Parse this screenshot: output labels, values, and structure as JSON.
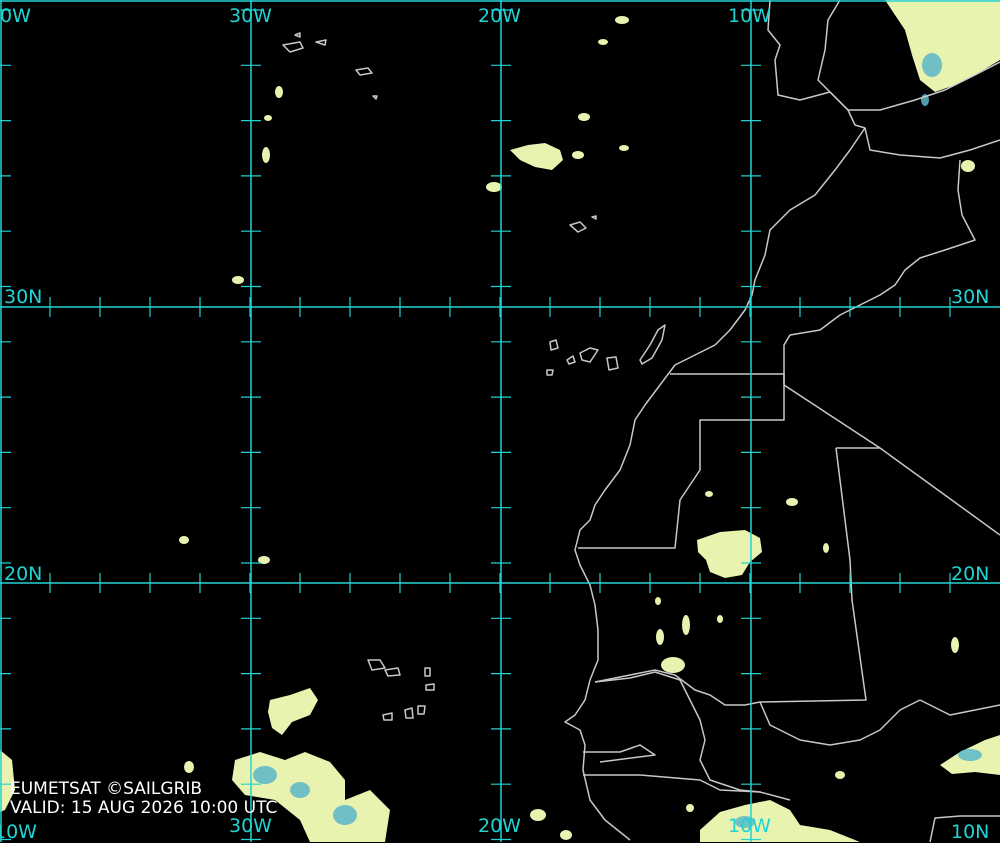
{
  "map": {
    "product": "satellite-cloud-image",
    "grid_color": "#22d3d3",
    "coast_color": "#c8c8c8",
    "cloud_color": "#e8f3b0",
    "deep_cloud_color": "#5bb7c9",
    "longitude_labels_top": [
      "0W",
      "30W",
      "20W",
      "10W"
    ],
    "longitude_labels_bottom": [
      "10W",
      "30W",
      "20W",
      "10W",
      "10N"
    ],
    "latitude_labels_left": [
      "30N",
      "20N"
    ],
    "latitude_labels_right": [
      "30N",
      "20N"
    ]
  },
  "credits": {
    "source": "EUMETSAT ©SAILGRIB",
    "valid": "VALID:  15 AUG 2026 10:00 UTC"
  }
}
